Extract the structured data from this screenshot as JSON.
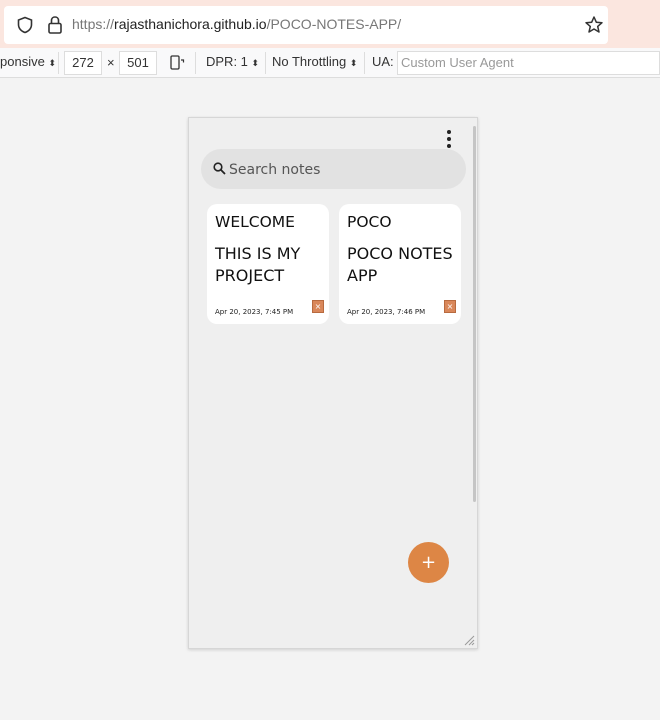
{
  "browser": {
    "url_scheme": "https://",
    "url_host": "rajasthanichora.github.io",
    "url_path": "/POCO-NOTES-APP/"
  },
  "responsive_toolbar": {
    "device_select": "ponsive",
    "width": "272",
    "times": "×",
    "height": "501",
    "dpr": "DPR: 1",
    "throttling": "No Throttling",
    "ua_label": "UA:",
    "ua_placeholder": "Custom User Agent"
  },
  "app": {
    "search_placeholder": "Search notes",
    "notes": [
      {
        "title": "WELCOME",
        "body": "THIS IS MY PROJECT",
        "date": "Apr 20, 2023, 7:45 PM"
      },
      {
        "title": "POCO",
        "body": "POCO NOTES APP",
        "date": "Apr 20, 2023, 7:46 PM"
      }
    ],
    "fab_label": "+",
    "delete_label": "×",
    "accent_color": "#dd8645"
  }
}
